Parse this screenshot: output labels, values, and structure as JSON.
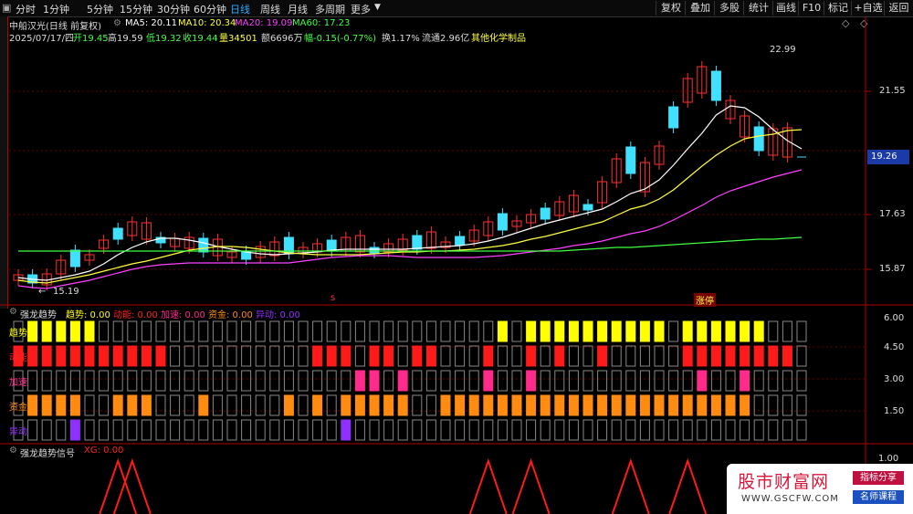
{
  "toolbar": {
    "timeframes": [
      "分时",
      "1分钟",
      "5分钟",
      "15分钟",
      "30分钟",
      "60分钟",
      "日线",
      "周线",
      "月线",
      "多周期",
      "更多"
    ],
    "active_timeframe": "日线",
    "buttons": [
      "复权",
      "叠加",
      "多股",
      "统计",
      "画线",
      "F10",
      "标记",
      "+自选",
      "返回"
    ]
  },
  "header": {
    "stock_name": "中船汉光(日线 前复权)",
    "ma5": "MA5: 20.11",
    "ma10": "MA10: 20.34",
    "ma20": "MA20: 19.09",
    "ma60": "MA60: 17.23",
    "date": "2025/07/17/四",
    "open": "开19.45",
    "high": "高19.59",
    "low": "低19.32",
    "close": "收19.44",
    "volume": "量34501",
    "amount": "额6696万",
    "change": "幅-0.15(-0.77%)",
    "turnover": "换1.17%",
    "float_cap": "流通2.96亿",
    "industry": "其他化学制品"
  },
  "main_chart": {
    "y_ticks": [
      "21.55",
      "17.63",
      "15.87"
    ],
    "current_price": "19.26",
    "high_annot": "22.99",
    "low_annot": "15.19",
    "event_s": "s",
    "event_zt": "涨停"
  },
  "ind1": {
    "title": "强龙趋势",
    "items": [
      {
        "label": "趋势: 0.00",
        "color": "#ffff00"
      },
      {
        "label": "动能: 0.00",
        "color": "#ff2020"
      },
      {
        "label": "加速: 0.00",
        "color": "#ff2a8a"
      },
      {
        "label": "资金: 0.00",
        "color": "#ff8c10"
      },
      {
        "label": "异动: 0.00",
        "color": "#9030ff"
      }
    ],
    "row_labels": [
      "趋势",
      "动能",
      "加速",
      "资金",
      "异动"
    ],
    "y_ticks": [
      "6.00",
      "4.50",
      "3.00",
      "1.50"
    ]
  },
  "ind2": {
    "title": "强龙趋势信号",
    "xg": "XG: 0.00",
    "y_tick": "1.00"
  },
  "chart_data": {
    "type": "candlestick",
    "n": 56,
    "rows": {
      "trend": [
        0,
        1,
        1,
        1,
        1,
        1,
        0,
        0,
        0,
        0,
        0,
        0,
        0,
        0,
        0,
        0,
        0,
        0,
        0,
        0,
        0,
        0,
        0,
        0,
        0,
        0,
        0,
        0,
        0,
        0,
        0,
        0,
        0,
        0,
        1,
        0,
        1,
        1,
        1,
        1,
        1,
        1,
        1,
        1,
        1,
        1,
        0,
        1,
        1,
        1,
        1,
        1,
        1,
        0,
        0,
        0
      ],
      "momentum": [
        1,
        1,
        1,
        1,
        1,
        1,
        1,
        1,
        1,
        1,
        1,
        0,
        0,
        0,
        0,
        0,
        0,
        0,
        0,
        0,
        0,
        1,
        1,
        1,
        0,
        1,
        1,
        0,
        1,
        1,
        0,
        0,
        0,
        1,
        0,
        0,
        1,
        0,
        1,
        0,
        0,
        1,
        0,
        0,
        0,
        0,
        0,
        1,
        1,
        1,
        1,
        1,
        1,
        1,
        1,
        0
      ],
      "accel": [
        0,
        0,
        0,
        0,
        0,
        0,
        0,
        0,
        0,
        0,
        0,
        0,
        0,
        0,
        0,
        0,
        0,
        0,
        0,
        0,
        0,
        0,
        0,
        0,
        1,
        1,
        0,
        1,
        0,
        0,
        0,
        0,
        0,
        1,
        0,
        0,
        1,
        0,
        0,
        0,
        0,
        0,
        0,
        0,
        0,
        0,
        0,
        0,
        1,
        0,
        0,
        1,
        0,
        0,
        0,
        0
      ],
      "fund": [
        0,
        1,
        1,
        1,
        1,
        0,
        0,
        1,
        1,
        1,
        0,
        0,
        0,
        1,
        0,
        0,
        0,
        0,
        0,
        1,
        0,
        1,
        0,
        1,
        1,
        1,
        1,
        1,
        0,
        0,
        1,
        1,
        1,
        1,
        1,
        1,
        1,
        1,
        1,
        1,
        1,
        1,
        1,
        1,
        1,
        1,
        1,
        1,
        1,
        1,
        1,
        1,
        0,
        0,
        0,
        0
      ],
      "anomaly": [
        0,
        0,
        0,
        0,
        1,
        0,
        0,
        0,
        0,
        0,
        0,
        0,
        0,
        0,
        0,
        0,
        0,
        0,
        0,
        0,
        0,
        0,
        0,
        1,
        0,
        0,
        0,
        0,
        0,
        0,
        0,
        0,
        0,
        0,
        0,
        0,
        0,
        0,
        0,
        0,
        0,
        0,
        0,
        0,
        0,
        0,
        0,
        0,
        0,
        0,
        0,
        0,
        0,
        0,
        0,
        0
      ]
    },
    "signals": [
      7,
      8,
      33,
      36,
      43,
      47
    ]
  },
  "watermark": {
    "title": "股市财富网",
    "url": "WWW.GSCFW.COM",
    "tag1": "指标分享",
    "tag2": "名师课程"
  }
}
